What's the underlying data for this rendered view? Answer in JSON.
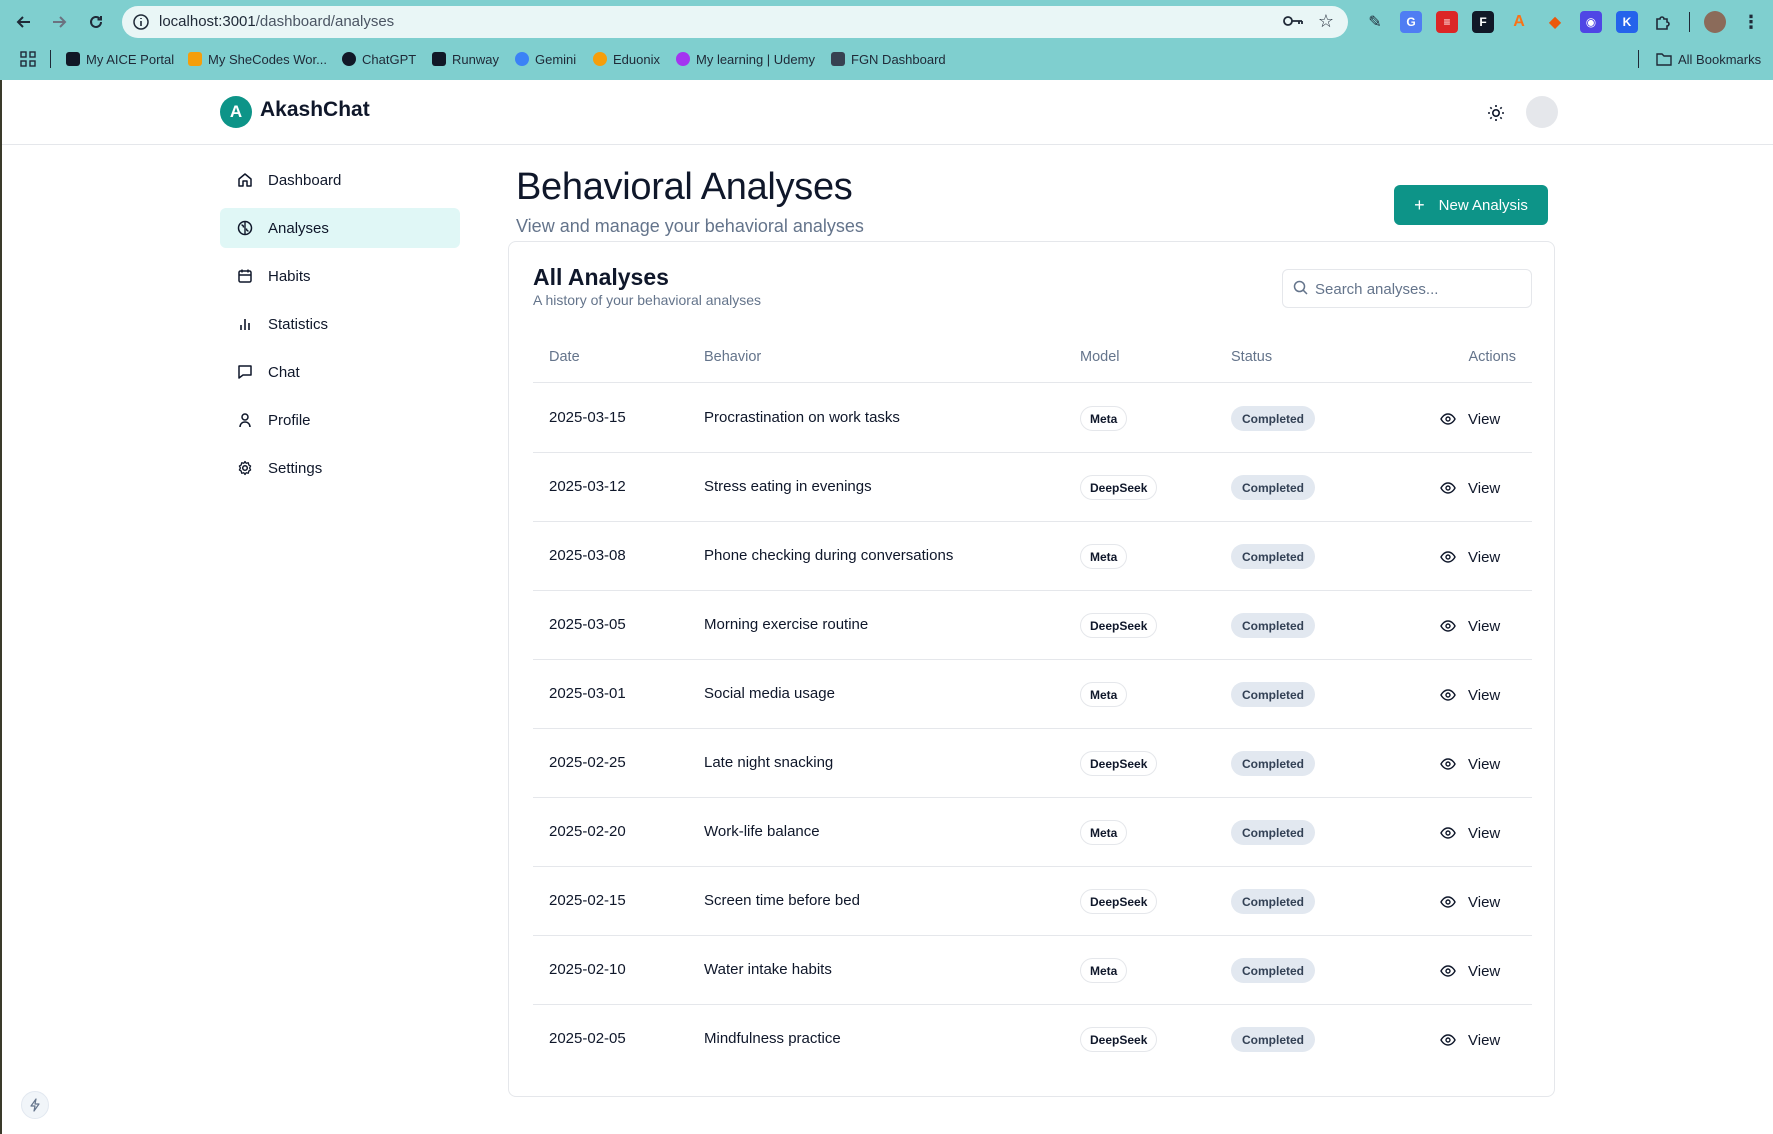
{
  "browser": {
    "url_host": "localhost:3001",
    "url_path": "/dashboard/analyses",
    "bookmarks": [
      {
        "label": "My AICE Portal"
      },
      {
        "label": "My SheCodes Wor..."
      },
      {
        "label": "ChatGPT"
      },
      {
        "label": "Runway"
      },
      {
        "label": "Gemini"
      },
      {
        "label": "Eduonix"
      },
      {
        "label": "My learning | Udemy"
      },
      {
        "label": "FGN Dashboard"
      }
    ],
    "all_bookmarks_label": "All Bookmarks"
  },
  "app": {
    "logo_letter": "A",
    "name": "AkashChat"
  },
  "sidebar": {
    "items": [
      {
        "label": "Dashboard",
        "icon": "home-icon"
      },
      {
        "label": "Analyses",
        "icon": "brain-icon",
        "active": true
      },
      {
        "label": "Habits",
        "icon": "calendar-icon"
      },
      {
        "label": "Statistics",
        "icon": "bar-chart-icon"
      },
      {
        "label": "Chat",
        "icon": "message-icon"
      },
      {
        "label": "Profile",
        "icon": "user-icon"
      },
      {
        "label": "Settings",
        "icon": "gear-icon"
      }
    ]
  },
  "page": {
    "title": "Behavioral Analyses",
    "subtitle": "View and manage your behavioral analyses",
    "new_button_label": "New Analysis"
  },
  "card": {
    "title": "All Analyses",
    "subtitle": "A history of your behavioral analyses",
    "search_placeholder": "Search analyses..."
  },
  "table": {
    "headers": {
      "date": "Date",
      "behavior": "Behavior",
      "model": "Model",
      "status": "Status",
      "actions": "Actions"
    },
    "rows": [
      {
        "date": "2025-03-15",
        "behavior": "Procrastination on work tasks",
        "model": "Meta",
        "status": "Completed",
        "action": "View"
      },
      {
        "date": "2025-03-12",
        "behavior": "Stress eating in evenings",
        "model": "DeepSeek",
        "status": "Completed",
        "action": "View"
      },
      {
        "date": "2025-03-08",
        "behavior": "Phone checking during conversations",
        "model": "Meta",
        "status": "Completed",
        "action": "View"
      },
      {
        "date": "2025-03-05",
        "behavior": "Morning exercise routine",
        "model": "DeepSeek",
        "status": "Completed",
        "action": "View"
      },
      {
        "date": "2025-03-01",
        "behavior": "Social media usage",
        "model": "Meta",
        "status": "Completed",
        "action": "View"
      },
      {
        "date": "2025-02-25",
        "behavior": "Late night snacking",
        "model": "DeepSeek",
        "status": "Completed",
        "action": "View"
      },
      {
        "date": "2025-02-20",
        "behavior": "Work-life balance",
        "model": "Meta",
        "status": "Completed",
        "action": "View"
      },
      {
        "date": "2025-02-15",
        "behavior": "Screen time before bed",
        "model": "DeepSeek",
        "status": "Completed",
        "action": "View"
      },
      {
        "date": "2025-02-10",
        "behavior": "Water intake habits",
        "model": "Meta",
        "status": "Completed",
        "action": "View"
      },
      {
        "date": "2025-02-05",
        "behavior": "Mindfulness practice",
        "model": "DeepSeek",
        "status": "Completed",
        "action": "View"
      }
    ]
  },
  "colors": {
    "accent": "#0d9488",
    "active_nav_bg": "#e0f7f6",
    "chrome_bg": "#7fcfcf",
    "status_badge_bg": "#e2e8f0"
  }
}
